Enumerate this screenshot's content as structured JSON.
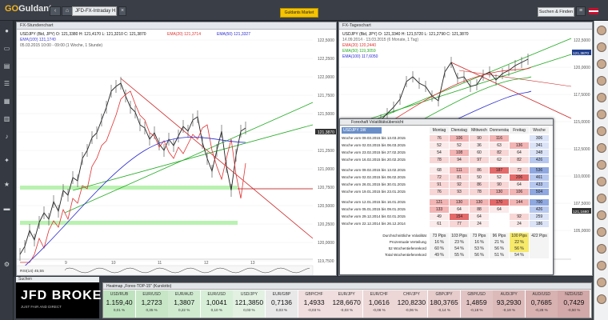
{
  "app": {
    "logo_go": "GO",
    "logo_rest": "Guldants",
    "symbol_tab": "JFD-FX-Intraday H1 D W",
    "market_button": "Guldants Market",
    "search_button": "Suchen & Finden"
  },
  "left_chart": {
    "title": "FX-Stundenchart",
    "legend_line1": "USDJPY (Bid, JPY)  O: 121,3380  H: 121,4170  L: 121,3210  C: 121,3870",
    "legend_line2": "EMA(100)  121,1740",
    "legend_line3": "05.03.2015 10:00 - 09:00 (1 Woche, 1 Stunde)",
    "ema20_label": "EMA(20)  121,3714",
    "ema50_label": "EMA(50)  121,3327",
    "price_labels": [
      "122,5000",
      "122,2500",
      "122,0000",
      "121,7500",
      "121,5000",
      "121,3870",
      "121,2500",
      "121,0000",
      "120,7500",
      "120,5000",
      "120,2500",
      "120,0000",
      "119,7500"
    ],
    "x_labels": [
      "9",
      "10",
      "11",
      "12",
      "13"
    ],
    "indicator_label": "RSI(14)  45,55",
    "colors": {
      "price": "#222222",
      "ema20": "#e03030",
      "ema50": "#2a2ad0",
      "trend_red": "#cc2222",
      "trend_green": "#22aa22",
      "zone": "#b9f2b0"
    }
  },
  "right_chart": {
    "title": "FX-Tageschart",
    "legend_line1": "USDJPY (Bid, JPY)  O: 121,3340  H: 121,5720  L: 121,2790  C: 121,3870",
    "legend_line2": "14.09.2014 - 13.03.2015 (6 Monate, 1 Tag)",
    "ema20_label": "EMA(20)  120,2440",
    "ema50_label": "EMA(50)  119,3059",
    "ema100_label": "EMA(100)  117,6050",
    "price_labels": [
      "122,5000",
      "120,0000",
      "117,5000",
      "115,0000",
      "112,5000",
      "110,0000",
      "107,5000",
      "105,0000"
    ],
    "right_labels": [
      "121,3870",
      "121,1680"
    ]
  },
  "volatility": {
    "window_title": "Forexhaft Volatilitätsübersicht",
    "tab": "USDJPY 1W",
    "columns": [
      "Montag",
      "Dienstag",
      "Mittwoch",
      "Donnerstag",
      "Freitag",
      "Woche"
    ],
    "rows": [
      {
        "label": "Woche vom 09.03.2015 bis 13.03.2015",
        "values": [
          "76",
          "106",
          "90",
          "116",
          "",
          "306"
        ]
      },
      {
        "label": "Woche vom 02.03.2015 bis 06.03.2015",
        "values": [
          "52",
          "52",
          "36",
          "63",
          "136",
          "341"
        ]
      },
      {
        "label": "Woche vom 23.02.2015 bis 27.02.2015",
        "values": [
          "54",
          "108",
          "60",
          "82",
          "64",
          "348"
        ]
      },
      {
        "label": "Woche vom 16.02.2015 bis 20.02.2015",
        "values": [
          "78",
          "94",
          "97",
          "62",
          "82",
          "426"
        ]
      },
      {
        "label": "Woche vom 09.02.2015 bis 13.02.2015",
        "values": [
          "68",
          "111",
          "86",
          "187",
          "72",
          "536"
        ]
      },
      {
        "label": "Woche vom 02.02.2015 bis 06.02.2015",
        "values": [
          "72",
          "81",
          "50",
          "52",
          "206",
          "461"
        ]
      },
      {
        "label": "Woche vom 26.01.2015 bis 30.01.2015",
        "values": [
          "91",
          "92",
          "86",
          "90",
          "64",
          "433"
        ]
      },
      {
        "label": "Woche vom 19.01.2015 bis 23.01.2015",
        "values": [
          "76",
          "93",
          "78",
          "130",
          "106",
          "504"
        ]
      },
      {
        "label": "Woche vom 12.01.2015 bis 16.01.2015",
        "values": [
          "121",
          "130",
          "130",
          "170",
          "144",
          "700"
        ]
      },
      {
        "label": "Woche vom 05.01.2015 bis 09.01.2015",
        "values": [
          "133",
          "64",
          "88",
          "64",
          "",
          "426"
        ]
      },
      {
        "label": "Woche vom 29.12.2014 bis 02.01.2015",
        "values": [
          "49",
          "154",
          "64",
          "",
          "92",
          "259"
        ]
      },
      {
        "label": "Woche vom 22.12.2014 bis 26.12.2014",
        "values": [
          "61",
          "77",
          "24",
          "",
          "24",
          "186"
        ]
      }
    ],
    "summary_labels": [
      "Durchschnittliche Volatilität",
      "Prozentuale Verteilung",
      "52 Wochentiefenrekord",
      "Total Wochentiefenrekord"
    ],
    "summary": [
      [
        "73 Pips",
        "103 Pips",
        "73 Pips",
        "96 Pips",
        "100 Pips",
        "422 Pips"
      ],
      [
        "16 %",
        "23 %",
        "16 %",
        "21 %",
        "22 %",
        ""
      ],
      [
        "60 %",
        "54 %",
        "53 %",
        "56 %",
        "56 %",
        ""
      ],
      [
        "49 %",
        "55 %",
        "56 %",
        "51 %",
        "54 %",
        ""
      ]
    ]
  },
  "bottom": {
    "input_label": "Suchen",
    "jfd_big": "JFD",
    "jfd_brand": "BROKERS",
    "jfd_small": "JUST FAIR AND DIRECT",
    "heatmap_title": "Heatmap „Forex-TOP-15\" (Kurslotto)",
    "tiles": [
      {
        "name": "USD/RUB",
        "value": "1.159,40",
        "change": "0,01 %",
        "color": "#bfe3bf"
      },
      {
        "name": "EUR/USD",
        "value": "1,2723",
        "change": "0,35 %",
        "color": "#c6e6c6"
      },
      {
        "name": "EUR/AUD",
        "value": "1,3807",
        "change": "0,22 %",
        "color": "#cfeacf"
      },
      {
        "name": "EUR/USD",
        "value": "1,0041",
        "change": "0,10 %",
        "color": "#d7eed7"
      },
      {
        "name": "USD/JPY",
        "value": "121,3850",
        "change": "0,03 %",
        "color": "#e2f1e2"
      },
      {
        "name": "EUR/GBP",
        "value": "0,7136",
        "change": "0,03 %",
        "color": "#e8e8e8"
      },
      {
        "name": "GBP/CHF",
        "value": "1,4933",
        "change": "-0,03 %",
        "color": "#f0dede"
      },
      {
        "name": "EUR/JPY",
        "value": "128,6670",
        "change": "-0,03 %",
        "color": "#f0dede"
      },
      {
        "name": "EUR/CHF",
        "value": "1,0616",
        "change": "-0,06 %",
        "color": "#ecd6d6"
      },
      {
        "name": "CHF/JPY",
        "value": "120,8230",
        "change": "-0,06 %",
        "color": "#ecd6d6"
      },
      {
        "name": "GBP/JPY",
        "value": "180,3765",
        "change": "-0,14 %",
        "color": "#e7cccc"
      },
      {
        "name": "GBP/USD",
        "value": "1,4859",
        "change": "-0,18 %",
        "color": "#e2c3c3"
      },
      {
        "name": "AUD/JPY",
        "value": "93,2930",
        "change": "-0,19 %",
        "color": "#ddbaba"
      },
      {
        "name": "AUD/USD",
        "value": "0,7685",
        "change": "-0,28 %",
        "color": "#d8b1b1"
      },
      {
        "name": "NZD/USD",
        "value": "0,7429",
        "change": "-0,50 %",
        "color": "#d3a8a8"
      }
    ]
  }
}
